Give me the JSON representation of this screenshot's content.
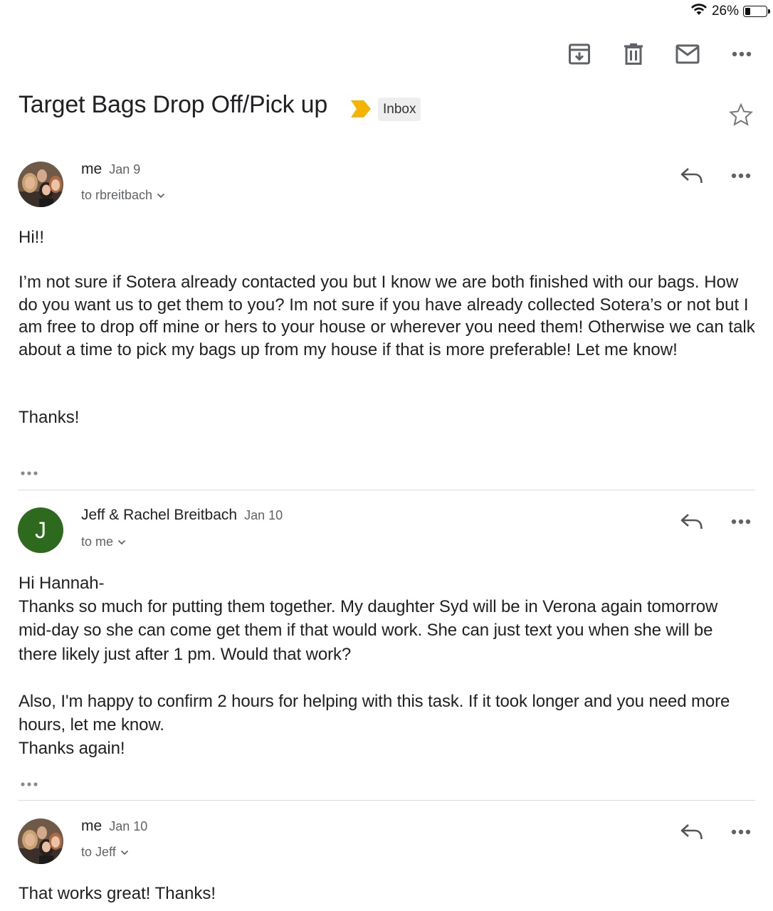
{
  "status_bar": {
    "battery": "26%",
    "battery_level": 0.26
  },
  "toolbar": {
    "archive_icon": "archive-icon",
    "delete_icon": "trash-icon",
    "mark_unread_icon": "mail-icon",
    "more_icon": "more-horizontal-icon"
  },
  "thread": {
    "subject": "Target Bags Drop Off/Pick up",
    "importance_color": "#f4b400",
    "label": "Inbox"
  },
  "messages": [
    {
      "sender": "me",
      "date": "Jan 9",
      "recipient": "to rbreitbach",
      "body": [
        "Hi!!",
        "I’m not sure if Sotera already contacted you but I know we are both finished with our bags. How do you want us to get them to you? Im not sure if you have already collected Sotera’s or not but I am free to drop off mine or hers to your house or wherever you need them! Otherwise we can talk about a time to pick my bags up from my house if that is more preferable! Let me know!",
        "Thanks!"
      ]
    },
    {
      "sender": "Jeff & Rachel Breitbach",
      "avatar_letter": "J",
      "avatar_color": "#2e6a1e",
      "date": "Jan 10",
      "recipient": "to me",
      "body": [
        "Hi Hannah-",
        "Thanks so much for putting them together. My daughter Syd will be in Verona again tomorrow mid-day so she can come get them if that would work.  She can just text you when she will be there likely just after 1 pm.  Would that work?",
        "Also, I'm happy to confirm 2 hours for helping with this task.  If it took longer and you need more hours, let me know.",
        "Thanks again!"
      ]
    },
    {
      "sender": "me",
      "date": "Jan 10",
      "recipient": "to Jeff",
      "body": [
        "That works great! Thanks!"
      ]
    }
  ]
}
